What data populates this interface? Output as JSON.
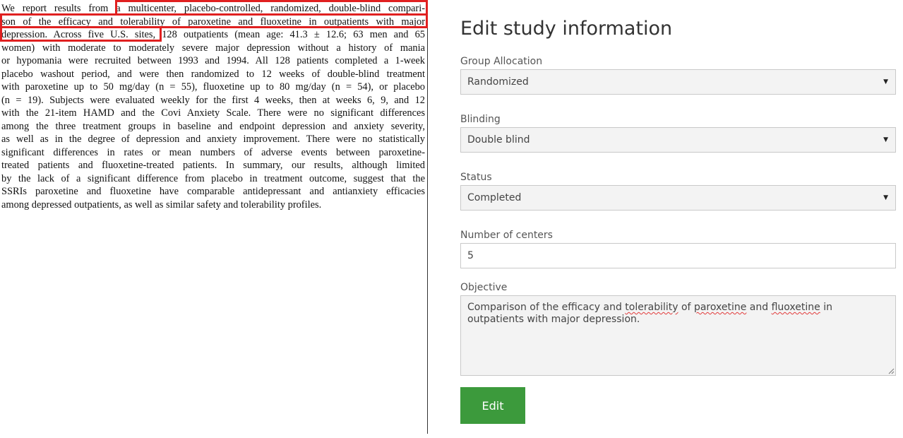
{
  "document": {
    "lines": [
      "We report results from a multicenter, placebo-controlled, randomized, double-blind compari-",
      "son of the efficacy and tolerability of paroxetine and fluoxetine in outpatients with major",
      "depression. Across five U.S. sites, 128 outpatients (mean age: 41.3 ± 12.6; 63 men and 65",
      "women) with moderate to moderately severe major depression without a history of mania",
      "or hypomania were recruited between 1993 and 1994. All 128 patients completed a 1-week",
      "placebo washout period, and were then randomized to 12 weeks of double-blind treatment",
      "with paroxetine up to 50 mg/day (n = 55), fluoxetine up to 80 mg/day (n = 54), or placebo",
      "(n = 19). Subjects were evaluated weekly for the first 4 weeks, then at weeks 6, 9, and 12",
      "with the 21-item HAMD and the Covi Anxiety Scale. There were no significant differences",
      "among the three treatment groups in baseline and endpoint depression and anxiety severity,",
      "as well as in the degree of depression and anxiety improvement. There were no statistically",
      "significant differences in rates or mean numbers of adverse events between paroxetine-",
      "treated patients and fluoxetine-treated patients. In summary, our results, although limited",
      "by the lack of a significant difference from placebo in treatment outcome, suggest that the",
      "SSRIs paroxetine and fluoxetine have comparable antidepressant and antianxiety efficacies",
      "among depressed outpatients, as well as similar safety and tolerability profiles."
    ],
    "highlight_color": "#e02020"
  },
  "form": {
    "title": "Edit study information",
    "group_allocation": {
      "label": "Group Allocation",
      "value": "Randomized"
    },
    "blinding": {
      "label": "Blinding",
      "value": "Double blind"
    },
    "status": {
      "label": "Status",
      "value": "Completed"
    },
    "centers": {
      "label": "Number of centers",
      "value": "5"
    },
    "objective": {
      "label": "Objective",
      "value_parts": [
        "Comparison of the efficacy and ",
        "tolerability",
        " of ",
        "paroxetine",
        " and ",
        "fluoxetine",
        " in outpatients with major depression."
      ]
    },
    "edit_button": "Edit",
    "caret_glyph": "▼",
    "button_color": "#3c9a3c"
  },
  "icons": {
    "select_caret": "chevron-down-icon",
    "resize": "resize-handle-icon"
  }
}
